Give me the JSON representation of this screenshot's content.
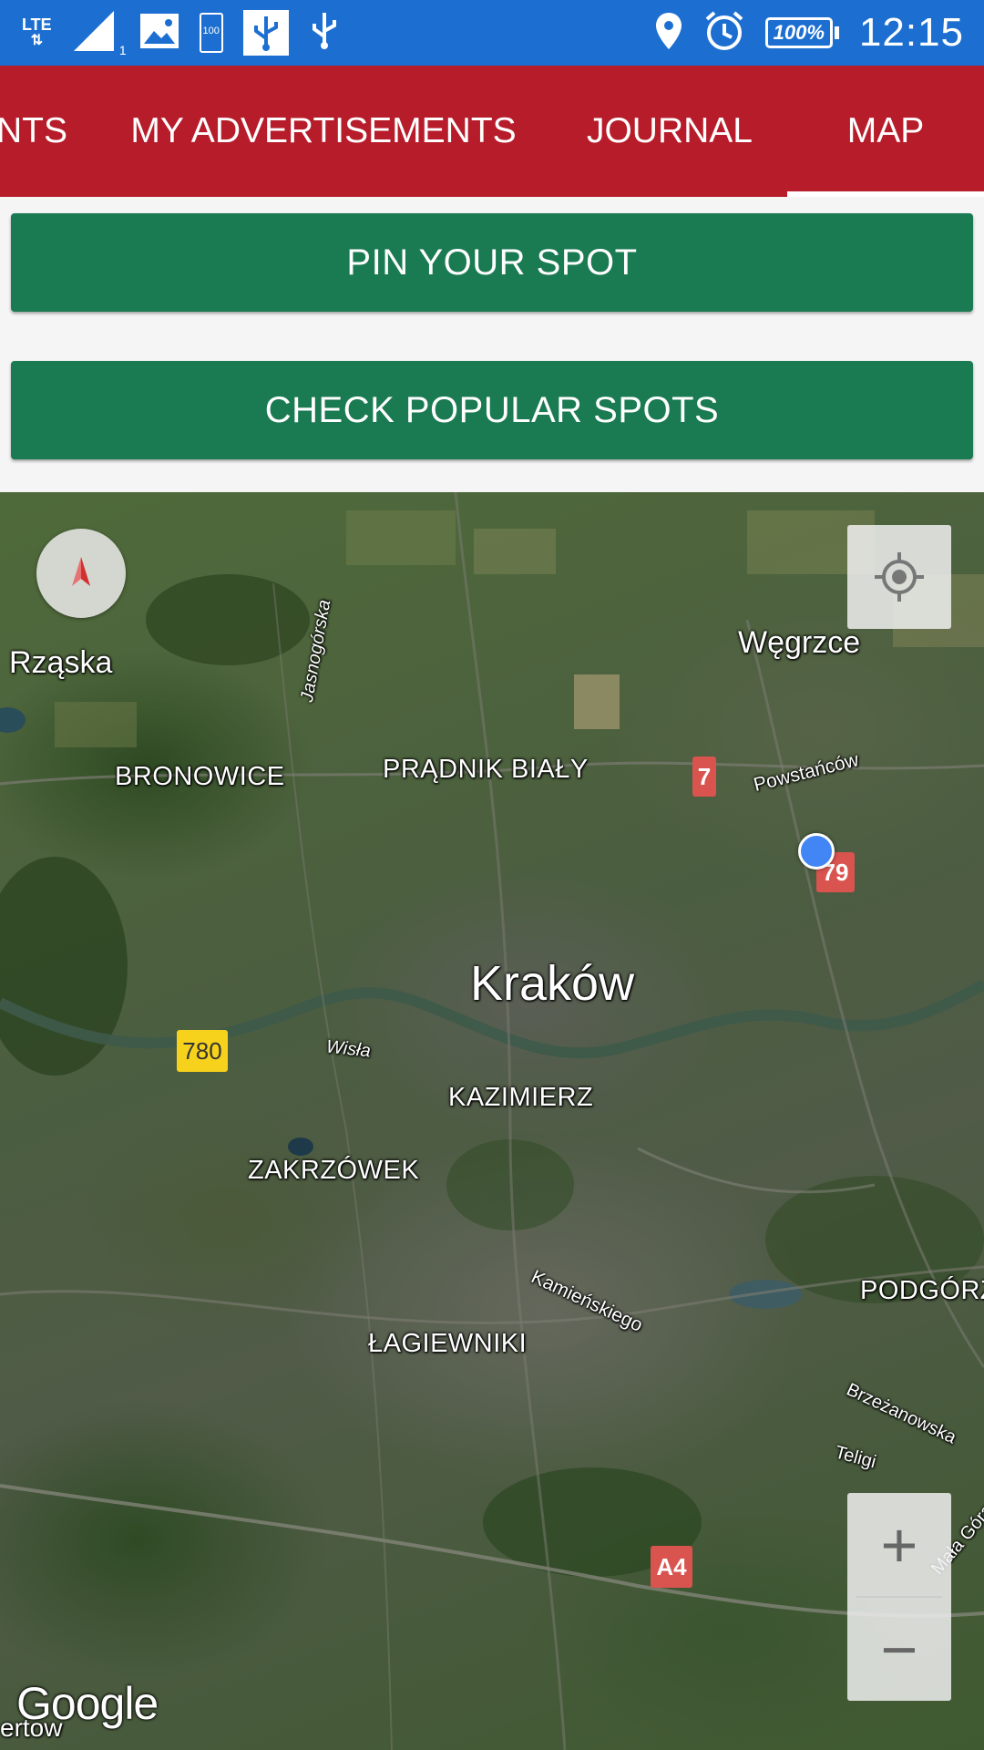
{
  "status_bar": {
    "network": "LTE",
    "signal_sub": "1",
    "battery_small": "100",
    "battery": "100%",
    "time": "12:15"
  },
  "tabs": [
    {
      "label": "NTS"
    },
    {
      "label": "MY ADVERTISEMENTS"
    },
    {
      "label": "JOURNAL"
    },
    {
      "label": "MAP",
      "selected": true
    }
  ],
  "buttons": {
    "pin": "PIN YOUR SPOT",
    "popular": "CHECK POPULAR SPOTS"
  },
  "map": {
    "labels": {
      "city": "Kraków",
      "rzaska": "Rząska",
      "wegrzce": "Węgrzce",
      "bronowice": "BRONOWICE",
      "pradnik": "PRĄDNIK BIAŁY",
      "kazimierz": "KAZIMIERZ",
      "zakrzowek": "ZAKRZÓWEK",
      "lagiewniki": "ŁAGIEWNIKI",
      "podgorze": "PODGÓRZE",
      "wisla": "Wisła",
      "jasnogorska": "Jasnogórska",
      "powstancow": "Powstańców",
      "kamienskiego": "Kamieńskiego",
      "brzezanowska": "Brzeżanowska",
      "teligi": "Teligi",
      "mala_gora": "Mała Góra",
      "ertow": "ertow"
    },
    "road_signs": {
      "r7": "7",
      "r79": "79",
      "r780": "780",
      "a4": "A4"
    },
    "controls": {
      "zoom_in": "+",
      "zoom_out": "−"
    },
    "attribution": "Google"
  },
  "colors": {
    "status_bar": "#1c6fd1",
    "tab_bar": "#b71c2a",
    "button": "#1a7a52",
    "road_sign_red": "#d9534f",
    "road_sign_yellow": "#f7d21c",
    "location_dot": "#4285f4"
  }
}
